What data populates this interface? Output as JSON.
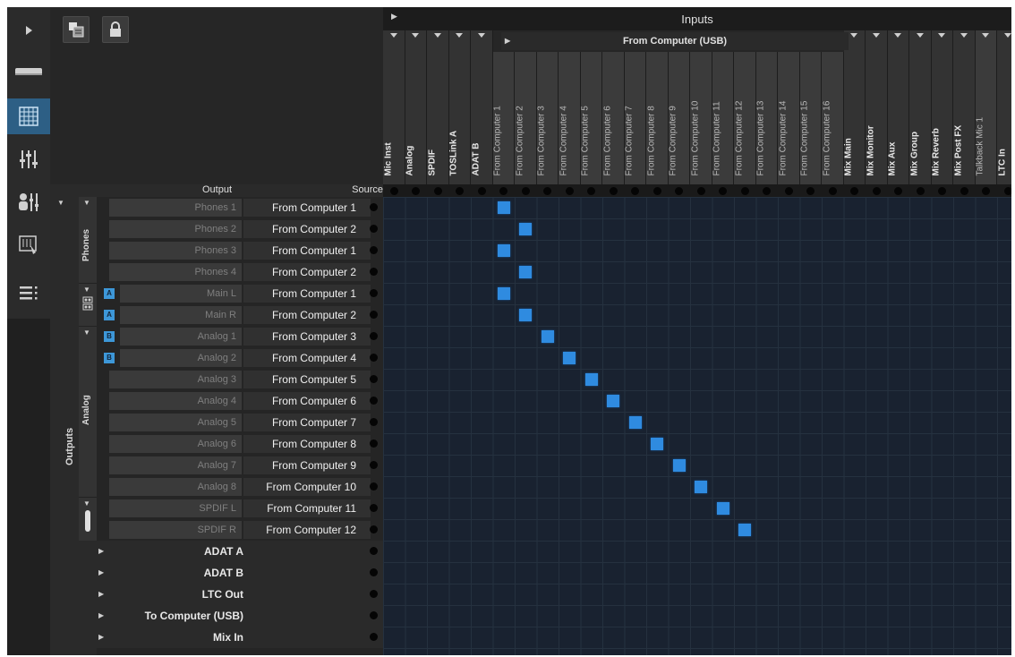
{
  "header": {
    "inputs_title": "Inputs",
    "usb_group_label": "From Computer (USB)"
  },
  "input_columns": [
    {
      "label": "Mic Inst",
      "group": "other"
    },
    {
      "label": "Analog",
      "group": "other"
    },
    {
      "label": "SPDIF",
      "group": "other"
    },
    {
      "label": "TOSLink A",
      "group": "other"
    },
    {
      "label": "ADAT B",
      "group": "other"
    },
    {
      "label": "From Computer 1",
      "group": "usb"
    },
    {
      "label": "From Computer 2",
      "group": "usb"
    },
    {
      "label": "From Computer 3",
      "group": "usb"
    },
    {
      "label": "From Computer 4",
      "group": "usb"
    },
    {
      "label": "From Computer 5",
      "group": "usb"
    },
    {
      "label": "From Computer 6",
      "group": "usb"
    },
    {
      "label": "From Computer 7",
      "group": "usb"
    },
    {
      "label": "From Computer 8",
      "group": "usb"
    },
    {
      "label": "From Computer 9",
      "group": "usb"
    },
    {
      "label": "From Computer 10",
      "group": "usb"
    },
    {
      "label": "From Computer 11",
      "group": "usb"
    },
    {
      "label": "From Computer 12",
      "group": "usb"
    },
    {
      "label": "From Computer 13",
      "group": "usb"
    },
    {
      "label": "From Computer 14",
      "group": "usb"
    },
    {
      "label": "From Computer 15",
      "group": "usb"
    },
    {
      "label": "From Computer 16",
      "group": "usb"
    },
    {
      "label": "Mix Main",
      "group": "other"
    },
    {
      "label": "Mix Monitor",
      "group": "other"
    },
    {
      "label": "Mix Aux",
      "group": "other"
    },
    {
      "label": "Mix Group",
      "group": "other"
    },
    {
      "label": "Mix Reverb",
      "group": "other"
    },
    {
      "label": "Mix Post FX",
      "group": "other"
    },
    {
      "label": "Talkback Mic 1",
      "group": "usb"
    },
    {
      "label": "LTC In",
      "group": "other"
    }
  ],
  "output_header": {
    "output_label": "Output",
    "source_label": "Source"
  },
  "group_labels": {
    "outputs": "Outputs",
    "phones": "Phones",
    "analog": "Analog"
  },
  "output_rows": [
    {
      "name": "Phones 1",
      "source": "From Computer 1",
      "marker": "",
      "route_col": 5
    },
    {
      "name": "Phones 2",
      "source": "From Computer 2",
      "marker": "",
      "route_col": 6
    },
    {
      "name": "Phones 3",
      "source": "From Computer 1",
      "marker": "",
      "route_col": 5
    },
    {
      "name": "Phones 4",
      "source": "From Computer 2",
      "marker": "",
      "route_col": 6
    },
    {
      "name": "Main L",
      "source": "From Computer 1",
      "marker": "A",
      "route_col": 5
    },
    {
      "name": "Main R",
      "source": "From Computer 2",
      "marker": "A",
      "route_col": 6
    },
    {
      "name": "Analog 1",
      "source": "From Computer 3",
      "marker": "B",
      "route_col": 7
    },
    {
      "name": "Analog 2",
      "source": "From Computer 4",
      "marker": "B",
      "route_col": 8
    },
    {
      "name": "Analog 3",
      "source": "From Computer 5",
      "marker": "",
      "route_col": 9
    },
    {
      "name": "Analog 4",
      "source": "From Computer 6",
      "marker": "",
      "route_col": 10
    },
    {
      "name": "Analog 5",
      "source": "From Computer 7",
      "marker": "",
      "route_col": 11
    },
    {
      "name": "Analog 6",
      "source": "From Computer 8",
      "marker": "",
      "route_col": 12
    },
    {
      "name": "Analog 7",
      "source": "From Computer 9",
      "marker": "",
      "route_col": 13
    },
    {
      "name": "Analog 8",
      "source": "From Computer 10",
      "marker": "",
      "route_col": 14
    },
    {
      "name": "SPDIF L",
      "source": "From Computer 11",
      "marker": "",
      "route_col": 15
    },
    {
      "name": "SPDIF R",
      "source": "From Computer 12",
      "marker": "",
      "route_col": 16
    }
  ],
  "collapsed_rows": [
    {
      "name": "ADAT A"
    },
    {
      "name": "ADAT B"
    },
    {
      "name": "LTC Out"
    },
    {
      "name": "To Computer (USB)"
    },
    {
      "name": "Mix In"
    }
  ],
  "sidebar_icons": [
    "expand-icon",
    "device-icon",
    "routing-grid-icon",
    "mixer-icon",
    "user-mixer-icon",
    "touch-screen-icon",
    "list-menu-icon"
  ],
  "toolbar_icons": [
    "window-layout-icon",
    "lock-icon"
  ],
  "colors": {
    "route_cell": "#2f8be0",
    "active_sidebar": "#2d5f85",
    "marker": "#3d97d8"
  }
}
